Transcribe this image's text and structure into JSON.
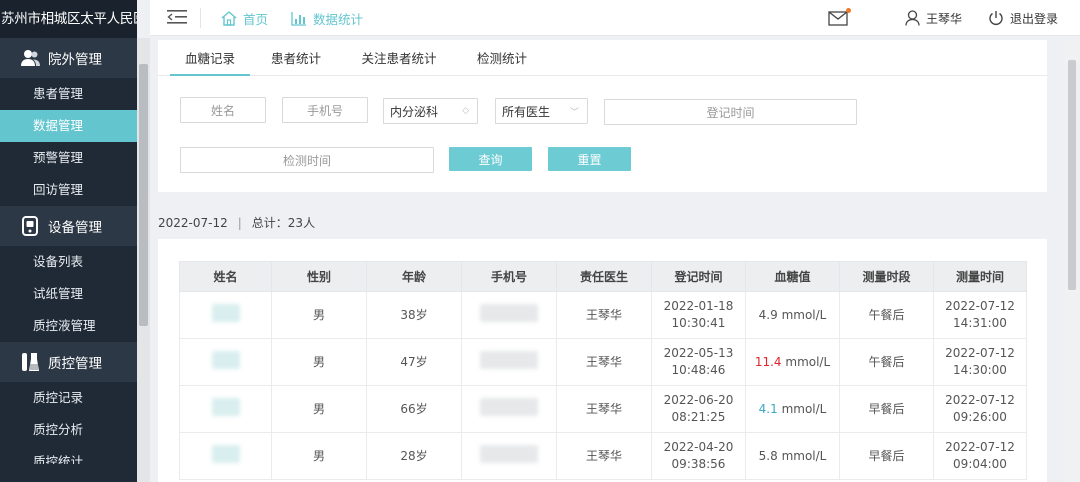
{
  "sidebar": {
    "hospital_name": "苏州市相城区太平人民医院",
    "groups": [
      {
        "label": "院外管理",
        "icon": "users-icon"
      },
      {
        "label": "设备管理",
        "icon": "device-icon"
      },
      {
        "label": "质控管理",
        "icon": "flask-icon"
      }
    ],
    "items": {
      "outpatient": [
        "患者管理",
        "数据管理",
        "预警管理",
        "回访管理"
      ],
      "device": [
        "设备列表",
        "试纸管理",
        "质控液管理"
      ],
      "quality": [
        "质控记录",
        "质控分析",
        "质控统计"
      ]
    },
    "active_item": "数据管理"
  },
  "header": {
    "home": "首页",
    "stats": "数据统计",
    "user": "王琴华",
    "logout": "退出登录",
    "accent": "#63c6cf",
    "notification_color": "#ef7a2a"
  },
  "tabs": [
    "血糖记录",
    "患者统计",
    "关注患者统计",
    "检测统计"
  ],
  "filters": {
    "name_placeholder": "姓名",
    "phone_placeholder": "手机号",
    "department": "内分泌科",
    "doctor": "所有医生",
    "register_time_placeholder": "登记时间",
    "test_time_placeholder": "检测时间",
    "search_label": "查询",
    "reset_label": "重置"
  },
  "summary": {
    "date": "2022-07-12",
    "total": "总计：23人"
  },
  "table": {
    "headers": [
      "姓名",
      "性别",
      "年龄",
      "手机号",
      "责任医生",
      "登记时间",
      "血糖值",
      "测量时段",
      "测量时间"
    ],
    "rows": [
      {
        "gender": "男",
        "age": "38岁",
        "doctor": "王琴华",
        "reg_time": "2022-01-18 10:30:41",
        "glucose": "4.9",
        "unit": "mmol/L",
        "glucose_status": "normal",
        "period": "午餐后",
        "test_time": "2022-07-12 14:31:00"
      },
      {
        "gender": "男",
        "age": "47岁",
        "doctor": "王琴华",
        "reg_time": "2022-05-13 10:48:46",
        "glucose": "11.4",
        "unit": "mmol/L",
        "glucose_status": "high",
        "period": "午餐后",
        "test_time": "2022-07-12 14:30:00"
      },
      {
        "gender": "男",
        "age": "66岁",
        "doctor": "王琴华",
        "reg_time": "2022-06-20 08:21:25",
        "glucose": "4.1",
        "unit": "mmol/L",
        "glucose_status": "low",
        "period": "早餐后",
        "test_time": "2022-07-12 09:26:00"
      },
      {
        "gender": "男",
        "age": "28岁",
        "doctor": "王琴华",
        "reg_time": "2022-04-20 09:38:56",
        "glucose": "5.8",
        "unit": "mmol/L",
        "glucose_status": "normal",
        "period": "早餐后",
        "test_time": "2022-07-12 09:04:00"
      }
    ]
  }
}
